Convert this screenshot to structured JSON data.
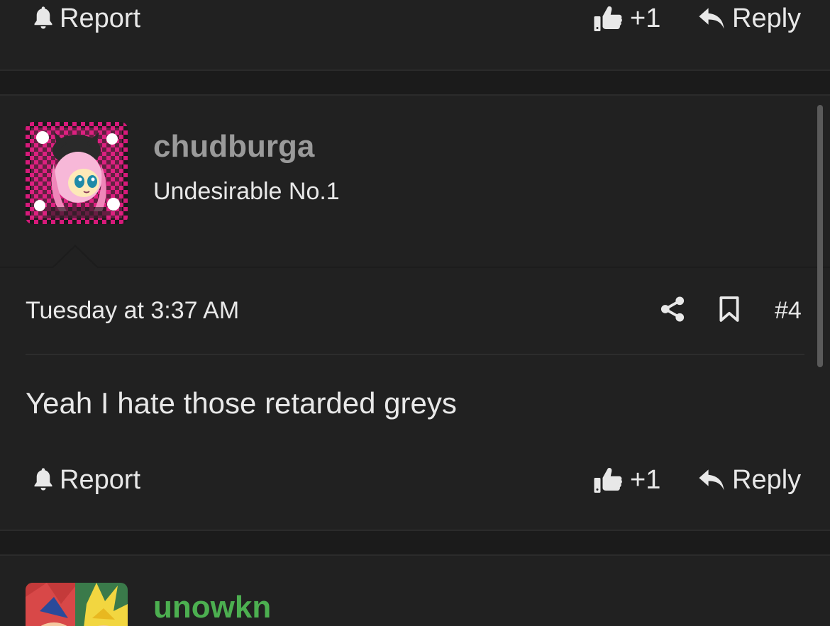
{
  "previous_post": {
    "report_label": "Report",
    "like_count": "+1",
    "reply_label": "Reply"
  },
  "post": {
    "username": "chudburga",
    "user_title": "Undesirable No.1",
    "timestamp": "Tuesday at 3:37 AM",
    "post_number": "#4",
    "message": "Yeah I hate those retarded greys",
    "report_label": "Report",
    "like_count": "+1",
    "reply_label": "Reply"
  },
  "next_post": {
    "username": "unowkn",
    "username_color": "#4caf50"
  },
  "icons": {
    "report": "bell-icon",
    "like": "thumbs-up-icon",
    "reply": "reply-arrow-icon",
    "share": "share-icon",
    "bookmark": "bookmark-icon"
  }
}
